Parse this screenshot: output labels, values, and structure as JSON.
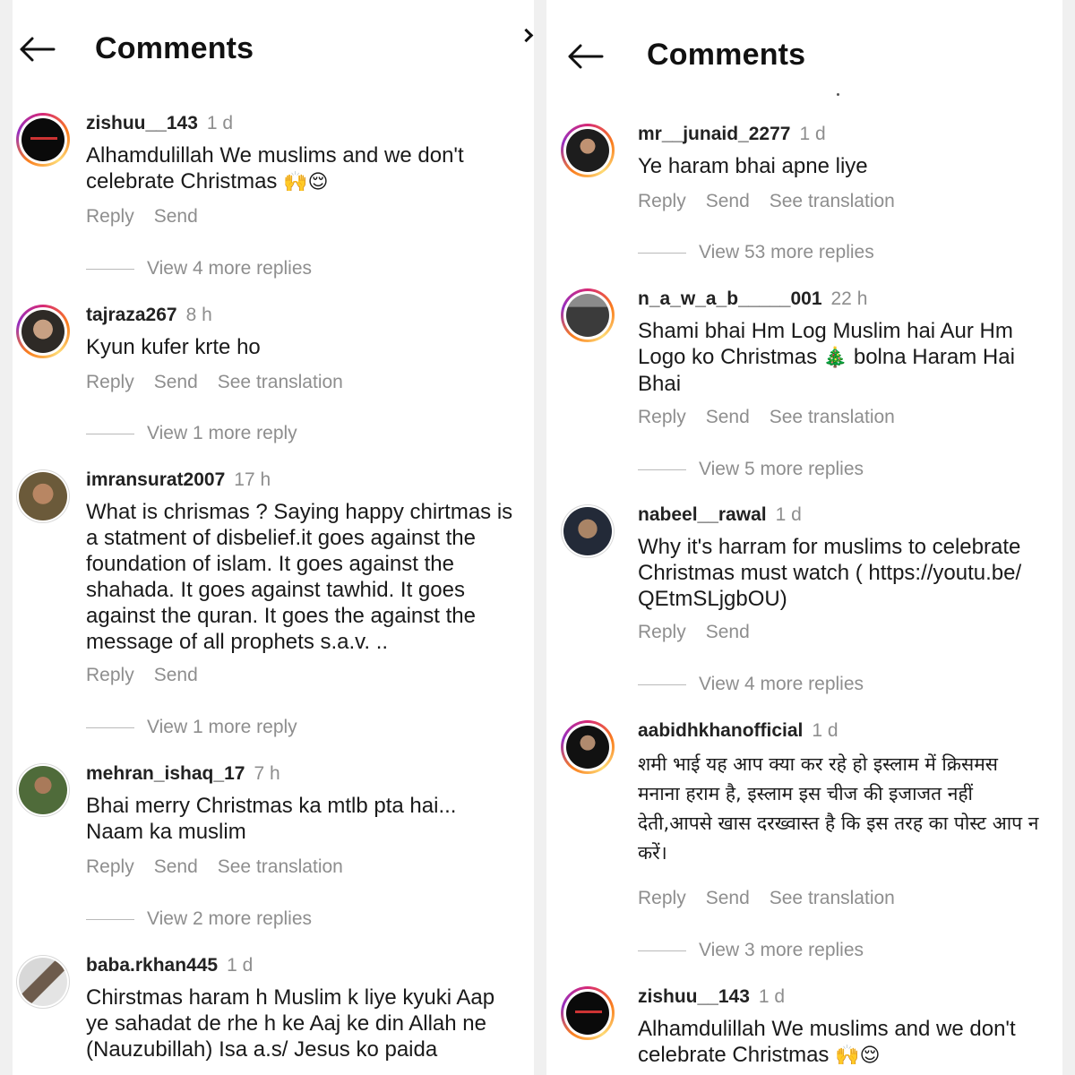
{
  "left": {
    "title": "Comments",
    "comments": [
      {
        "username": "zishuu__143",
        "time": "1 d",
        "text": "Alhamdulillah We muslims and we don't celebrate Christmas",
        "emoji": "🙌😌",
        "reply": "Reply",
        "send": "Send",
        "replies": "View 4 more replies"
      },
      {
        "username": "tajraza267",
        "time": "8 h",
        "text": "Kyun kufer krte ho",
        "reply": "Reply",
        "send": "Send",
        "translation": "See translation",
        "replies": "View 1 more reply"
      },
      {
        "username": "imransurat2007",
        "time": "17 h",
        "text": "What is chrismas ?  Saying happy chirtmas is a statment of disbelief.it goes against the foundation of islam. It goes against the shahada. It goes against tawhid. It goes against the quran. It goes the against the message of all prophets s.a.v. ..",
        "reply": "Reply",
        "send": "Send",
        "replies": "View 1 more reply"
      },
      {
        "username": "mehran_ishaq_17",
        "time": "7 h",
        "text": "Bhai merry Christmas ka mtlb pta hai... Naam ka muslim",
        "reply": "Reply",
        "send": "Send",
        "translation": "See translation",
        "replies": "View 2 more replies"
      },
      {
        "username": "baba.rkhan445",
        "time": "1 d",
        "text": "Chirstmas haram h Muslim k liye kyuki Aap ye sahadat de rhe h ke Aaj ke din Allah ne (Nauzubillah) Isa a.s/ Jesus ko paida"
      }
    ]
  },
  "right": {
    "title": "Comments",
    "comments": [
      {
        "username": "mr__junaid_2277",
        "time": "1 d",
        "text": "Ye haram bhai  apne liye",
        "reply": "Reply",
        "send": "Send",
        "translation": "See translation",
        "replies": "View 53 more replies"
      },
      {
        "username": "n_a_w_a_b_____001",
        "time": "22 h",
        "text_a": "Shami bhai Hm Log Muslim hai Aur Hm Logo ko Christmas",
        "emoji": "🎄",
        "text_b": "bolna Haram Hai Bhai",
        "reply": "Reply",
        "send": "Send",
        "translation": "See translation",
        "replies": "View 5 more replies"
      },
      {
        "username": "nabeel__rawal",
        "time": "1 d",
        "text": "Why it's harram for muslims to celebrate Christmas must watch ( https://youtu.be/ QEtmSLjgbOU)",
        "reply": "Reply",
        "send": "Send",
        "replies": "View 4 more replies"
      },
      {
        "username": "aabidhkhanofficial",
        "time": "1 d",
        "text": "शमी भाई यह आप क्या कर रहे हो इस्लाम में क्रिसमस मनाना हराम है, इस्लाम इस चीज की इजाजत नहीं देती,आपसे खास दरख्वास्त है कि इस तरह का पोस्ट आप न करें।",
        "reply": "Reply",
        "send": "Send",
        "translation": "See translation",
        "replies": "View 3 more replies"
      },
      {
        "username": "zishuu__143",
        "time": "1 d",
        "text": "Alhamdulillah We muslims and we don't celebrate Christmas",
        "emoji": "🙌😌"
      }
    ]
  },
  "icons": {
    "back": "back-arrow-icon"
  },
  "colors": {
    "username": "#222222",
    "secondary": "#8e8e8e",
    "story_ring": "#d62976",
    "background": "#ffffff"
  }
}
